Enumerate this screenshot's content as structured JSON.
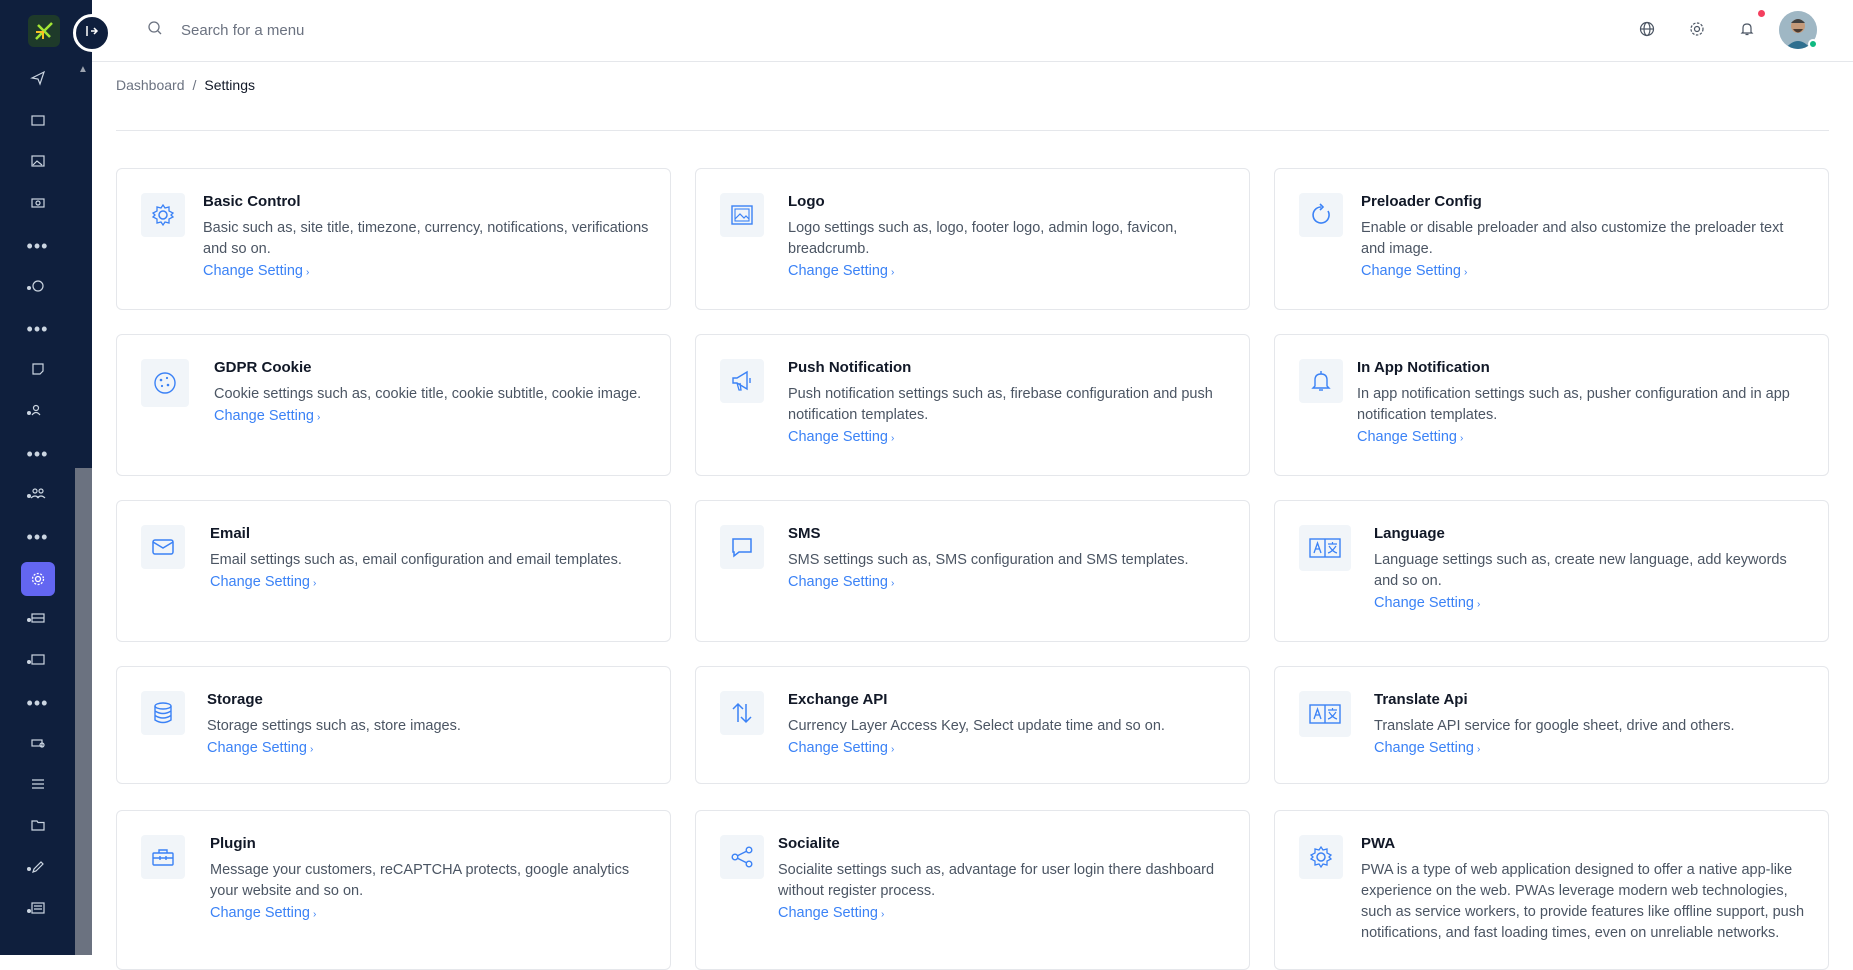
{
  "search": {
    "placeholder": "Search for a menu"
  },
  "breadcrumb": {
    "items": [
      "Dashboard",
      "Settings"
    ],
    "separator": "/"
  },
  "cards": [
    {
      "title": "Basic Control",
      "desc": "Basic such as, site title, timezone, currency, notifications, verifications and so on.",
      "link": "Change Setting",
      "icon": "gear-icon"
    },
    {
      "title": "Logo",
      "desc": "Logo settings such as, logo, footer logo, admin logo, favicon, breadcrumb.",
      "link": "Change Setting",
      "icon": "image-icon"
    },
    {
      "title": "Preloader Config",
      "desc": "Enable or disable preloader and also customize the preloader text and image.",
      "link": "Change Setting",
      "icon": "refresh-icon"
    },
    {
      "title": "GDPR Cookie",
      "desc": "Cookie settings such as, cookie title, cookie subtitle, cookie image.",
      "link": "Change Setting",
      "icon": "cookie-icon"
    },
    {
      "title": "Push Notification",
      "desc": "Push notification settings such as, firebase configuration and push notification templates.",
      "link": "Change Setting",
      "icon": "megaphone-icon"
    },
    {
      "title": "In App Notification",
      "desc": "In app notification settings such as, pusher configuration and in app notification templates.",
      "link": "Change Setting",
      "icon": "bell-icon"
    },
    {
      "title": "Email",
      "desc": "Email settings such as, email configuration and email templates.",
      "link": "Change Setting",
      "icon": "mail-icon"
    },
    {
      "title": "SMS",
      "desc": "SMS settings such as, SMS configuration and SMS templates.",
      "link": "Change Setting",
      "icon": "message-icon"
    },
    {
      "title": "Language",
      "desc": "Language settings such as, create new language, add keywords and so on.",
      "link": "Change Setting",
      "icon": "translate-icon"
    },
    {
      "title": "Storage",
      "desc": "Storage settings such as, store images.",
      "link": "Change Setting",
      "icon": "database-icon"
    },
    {
      "title": "Exchange API",
      "desc": "Currency Layer Access Key, Select update time and so on.",
      "link": "Change Setting",
      "icon": "exchange-icon"
    },
    {
      "title": "Translate Api",
      "desc": "Translate API service for google sheet, drive and others.",
      "link": "Change Setting",
      "icon": "translate-icon"
    },
    {
      "title": "Plugin",
      "desc": "Message your customers, reCAPTCHA protects, google analytics your website and so on.",
      "link": "Change Setting",
      "icon": "toolbox-icon"
    },
    {
      "title": "Socialite",
      "desc": "Socialite settings such as, advantage for user login there dashboard without register process.",
      "link": "Change Setting",
      "icon": "share-icon"
    },
    {
      "title": "PWA",
      "desc": "PWA is a type of web application designed to offer a native app-like experience on the web. PWAs leverage modern web technologies, such as service workers, to provide features like offline support, push notifications, and fast loading times, even on unreliable networks.",
      "link": "",
      "icon": "gear-icon"
    }
  ],
  "colors": {
    "sidebar": "#0f1f3d",
    "accent": "#6366f1",
    "link": "#3b82f6"
  }
}
